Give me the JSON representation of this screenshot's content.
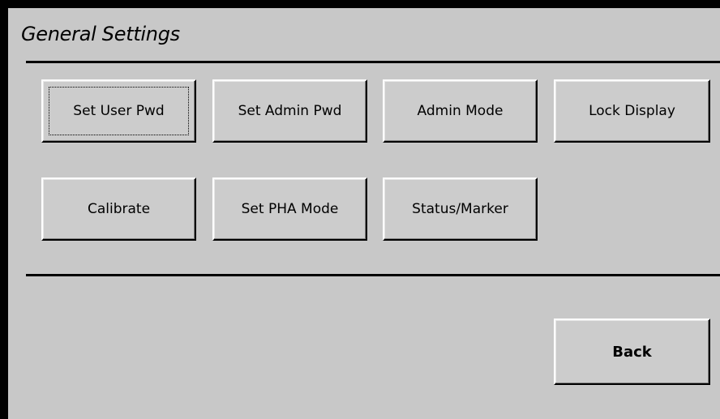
{
  "window": {
    "title": "General Settings"
  },
  "buttons": {
    "set_user_pwd": "Set User Pwd",
    "set_admin_pwd": "Set Admin Pwd",
    "admin_mode": "Admin Mode",
    "lock_display": "Lock Display",
    "calibrate": "Calibrate",
    "set_pha_mode": "Set PHA Mode",
    "status_marker": "Status/Marker",
    "back": "Back"
  },
  "colors": {
    "background": "#c8c8c8",
    "frame": "#000000",
    "text": "#000000"
  },
  "focused_button": "set_user_pwd"
}
